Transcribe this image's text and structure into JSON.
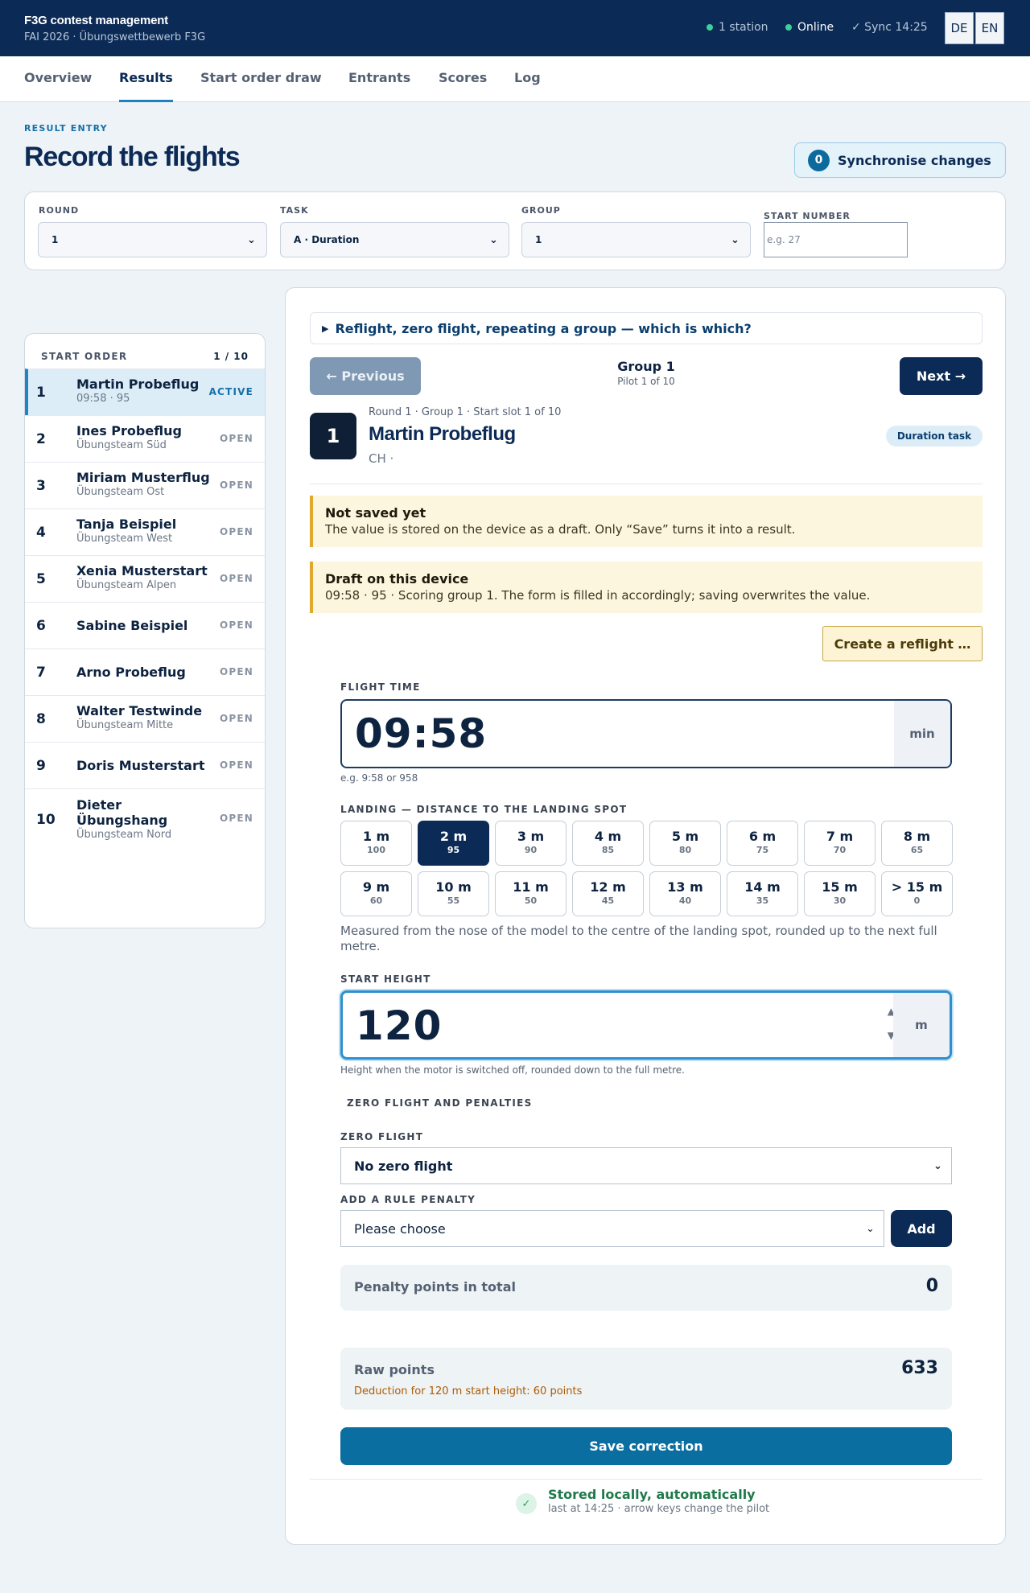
{
  "header": {
    "title": "F3G contest management",
    "subtitle": "FAI 2026 · Übungswettbewerb F3G",
    "stations": "1 station",
    "online": "Online",
    "sync": "✓ Sync 14:25",
    "lang_de": "DE",
    "lang_en": "EN",
    "status_color": "#3ecf9a"
  },
  "tabs": [
    "Overview",
    "Results",
    "Start order draw",
    "Entrants",
    "Scores",
    "Log"
  ],
  "active_tab": "Results",
  "page": {
    "eyebrow": "RESULT ENTRY",
    "title": "Record the flights",
    "sync_count": "0",
    "sync_label": "Synchronise changes"
  },
  "filters": {
    "round_label": "ROUND",
    "round_value": "1",
    "task_label": "TASK",
    "task_value": "A · Duration",
    "group_label": "GROUP",
    "group_value": "1",
    "start_label": "START NUMBER",
    "start_placeholder": "e.g. 27"
  },
  "start_order": {
    "label": "START ORDER",
    "count": "1 / 10",
    "rows": [
      {
        "num": "1",
        "name": "Martin Probeflug",
        "sub": "09:58 · 95",
        "state": "ACTIVE"
      },
      {
        "num": "2",
        "name": "Ines Probeflug",
        "sub": "Übungsteam Süd",
        "state": "OPEN"
      },
      {
        "num": "3",
        "name": "Miriam Musterflug",
        "sub": "Übungsteam Ost",
        "state": "OPEN"
      },
      {
        "num": "4",
        "name": "Tanja Beispiel",
        "sub": "Übungsteam West",
        "state": "OPEN"
      },
      {
        "num": "5",
        "name": "Xenia Musterstart",
        "sub": "Übungsteam Alpen",
        "state": "OPEN"
      },
      {
        "num": "6",
        "name": "Sabine Beispiel",
        "sub": "",
        "state": "OPEN"
      },
      {
        "num": "7",
        "name": "Arno Probeflug",
        "sub": "",
        "state": "OPEN"
      },
      {
        "num": "8",
        "name": "Walter Testwinde",
        "sub": "Übungsteam Mitte",
        "state": "OPEN"
      },
      {
        "num": "9",
        "name": "Doris Musterstart",
        "sub": "",
        "state": "OPEN"
      },
      {
        "num": "10",
        "name": "Dieter Übungshang",
        "sub": "Übungsteam Nord",
        "state": "OPEN"
      }
    ]
  },
  "entry": {
    "details_summary": "Reflight, zero flight, repeating a group — which is which?",
    "prev_label": "← Previous",
    "next_label": "Next →",
    "group_title": "Group 1",
    "group_sub": "Pilot 1 of 10",
    "pilot_number": "1",
    "pilot_meta": "Round 1 · Group 1 · Start slot 1 of 10",
    "pilot_name": "Martin Probeflug",
    "pilot_country": "CH ·",
    "task_chip": "Duration task",
    "notice1_title": "Not saved yet",
    "notice1_text": "The value is stored on the device as a draft. Only “Save” turns it into a result.",
    "notice2_title": "Draft on this device",
    "notice2_text": "09:58 · 95 · Scoring group 1. The form is filled in accordingly; saving overwrites the value.",
    "reflight_label": "Create a reflight …",
    "flight_time_label": "FLIGHT TIME",
    "flight_time_value": "09:58",
    "flight_time_unit": "min",
    "flight_time_hint": "e.g. 9:58 or 958",
    "landing_label": "LANDING — DISTANCE TO THE LANDING SPOT",
    "landing_options": [
      {
        "m": "1 m",
        "p": "100"
      },
      {
        "m": "2 m",
        "p": "95"
      },
      {
        "m": "3 m",
        "p": "90"
      },
      {
        "m": "4 m",
        "p": "85"
      },
      {
        "m": "5 m",
        "p": "80"
      },
      {
        "m": "6 m",
        "p": "75"
      },
      {
        "m": "7 m",
        "p": "70"
      },
      {
        "m": "8 m",
        "p": "65"
      },
      {
        "m": "9 m",
        "p": "60"
      },
      {
        "m": "10 m",
        "p": "55"
      },
      {
        "m": "11 m",
        "p": "50"
      },
      {
        "m": "12 m",
        "p": "45"
      },
      {
        "m": "13 m",
        "p": "40"
      },
      {
        "m": "14 m",
        "p": "35"
      },
      {
        "m": "15 m",
        "p": "30"
      },
      {
        "m": "> 15 m",
        "p": "0"
      }
    ],
    "landing_selected": "2 m",
    "landing_hint": "Measured from the nose of the model to the centre of the landing spot, rounded up to the next full metre.",
    "start_height_label": "START HEIGHT",
    "start_height_value": "120",
    "start_height_unit": "m",
    "start_height_hint": "Height when the motor is switched off, rounded down to the full metre.",
    "penalties_heading": "ZERO FLIGHT AND PENALTIES",
    "zero_flight_label": "ZERO FLIGHT",
    "zero_flight_value": "No zero flight",
    "rule_penalty_label": "ADD A RULE PENALTY",
    "rule_penalty_value": "Please choose",
    "add_label": "Add",
    "penalty_total_label": "Penalty points in total",
    "penalty_total_value": "0",
    "raw_points_label": "Raw points",
    "raw_points_value": "633",
    "raw_points_note": "Deduction for 120 m start height: 60 points",
    "save_label": "Save correction",
    "stored_title": "Stored locally, automatically",
    "stored_sub": "last at 14:25 · arrow keys change the pilot"
  }
}
